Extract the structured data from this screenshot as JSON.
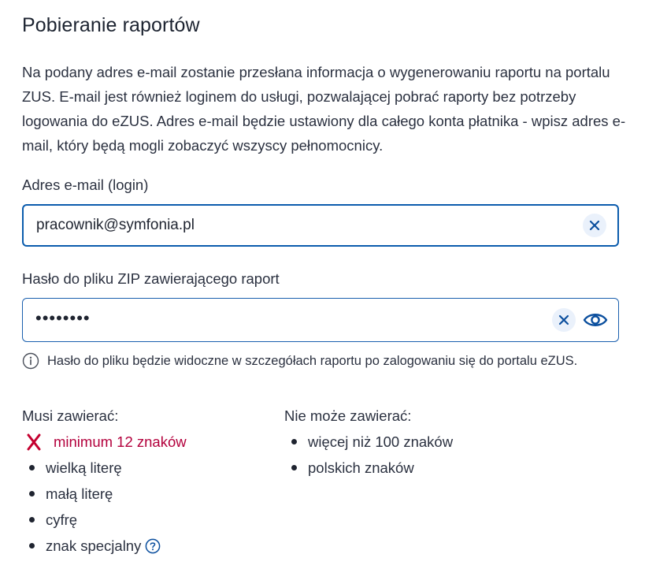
{
  "title": "Pobieranie raportów",
  "description": "Na podany adres e-mail zostanie przesłana informacja o wygenerowaniu raportu na portalu ZUS. E-mail jest również loginem do usługi, pozwalającej pobrać raporty bez potrzeby logowania do eZUS. Adres e-mail będzie ustawiony dla całego konta płatnika - wpisz adres e-mail, który będą mogli zobaczyć wszyscy pełnomocnicy.",
  "email": {
    "label": "Adres e-mail (login)",
    "value": "pracownik@symfonia.pl"
  },
  "password": {
    "label": "Hasło do pliku ZIP zawierającego raport",
    "masked_value": "••••••••",
    "hint": "Hasło do pliku będzie widoczne w szczegółach raportu po zalogowaniu się do portalu eZUS."
  },
  "must_contain": {
    "title": "Musi zawierać:",
    "items": [
      {
        "label": "minimum 12 znaków",
        "status": "error"
      },
      {
        "label": "wielką literę",
        "status": "neutral"
      },
      {
        "label": "małą literę",
        "status": "neutral"
      },
      {
        "label": "cyfrę",
        "status": "neutral"
      },
      {
        "label": "znak specjalny",
        "status": "neutral",
        "has_help": true
      }
    ]
  },
  "must_not_contain": {
    "title": "Nie może zawierać:",
    "items": [
      {
        "label": "więcej niż 100 znaków"
      },
      {
        "label": "polskich znaków"
      }
    ]
  },
  "colors": {
    "accent": "#0b5cad",
    "error": "#b3003c",
    "text": "#2b3140"
  },
  "icons": [
    "close-icon",
    "eye-icon",
    "info-icon",
    "error-x-icon",
    "help-icon"
  ]
}
